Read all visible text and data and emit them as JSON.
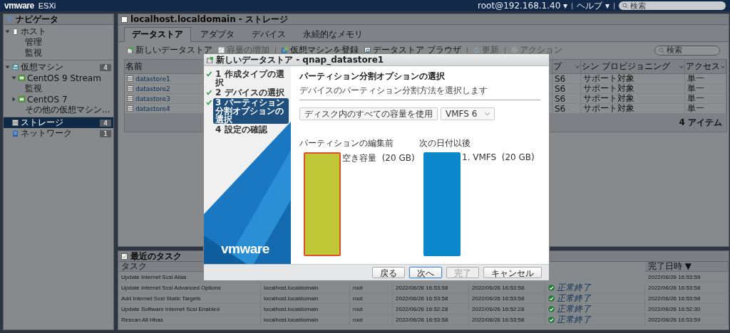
{
  "top_bar": {
    "logo": "vmware",
    "product": "ESXi",
    "user": "root@192.168.1.40 ▾",
    "help": "ヘルプ ▾",
    "search": {
      "placeholder": "検索"
    }
  },
  "navigator": {
    "title": "ナビゲータ",
    "items": [
      {
        "label": "ホスト",
        "kind": "host",
        "expanded": true,
        "selected": false,
        "children": [
          {
            "label": "管理",
            "selected": false
          },
          {
            "label": "監視",
            "selected": false
          }
        ]
      },
      {
        "label": "仮想マシン",
        "kind": "vms",
        "count": "4",
        "expanded": true,
        "selected": false,
        "children": [
          {
            "label": "CentOS 9 Stream",
            "kind": "vm",
            "expanded": true,
            "selected": false,
            "children": [
              {
                "label": "監視",
                "selected": false
              }
            ]
          },
          {
            "label": "CentOS 7",
            "kind": "vm",
            "expanded": false,
            "selected": false
          },
          {
            "label": "その他の仮想マシン...",
            "selected": false
          }
        ]
      },
      {
        "label": "ストレージ",
        "kind": "storage",
        "count": "4",
        "selected": true
      },
      {
        "label": "ネットワーク",
        "kind": "network",
        "count": "1",
        "selected": false
      }
    ]
  },
  "main": {
    "title": "localhost.localdomain - ストレージ",
    "tabs": [
      {
        "label": "データストア",
        "selected": true
      },
      {
        "label": "アダプタ",
        "selected": false
      },
      {
        "label": "デバイス",
        "selected": false
      },
      {
        "label": "永続的なメモリ",
        "selected": false
      }
    ],
    "toolbar": [
      [
        {
          "label": "新しいデータストア",
          "kind": "new",
          "disabled": false
        },
        {
          "label": "容量の増加",
          "kind": "grow",
          "disabled": true
        }
      ],
      [
        {
          "label": "仮想マシンを登録",
          "kind": "register",
          "disabled": false
        },
        {
          "label": "データストア ブラウザ",
          "kind": "browser",
          "disabled": false
        }
      ],
      [
        {
          "label": "更新",
          "kind": "refresh",
          "disabled": true
        }
      ],
      [
        {
          "label": "アクション",
          "kind": "gear",
          "disabled": true
        }
      ]
    ],
    "search": {
      "placeholder": "検索"
    },
    "table": {
      "columns": [
        "名前",
        "プ",
        "シン プロビジョニング",
        "アクセス"
      ],
      "rows": [
        [
          "datastore1",
          "S6",
          "サポート対象",
          "単一"
        ],
        [
          "datastore2",
          "S6",
          "サポート対象",
          "単一"
        ],
        [
          "datastore3",
          "S6",
          "サポート対象",
          "単一"
        ],
        [
          "datastore4",
          "S6",
          "サポート対象",
          "単一"
        ]
      ],
      "footer": "4 アイテム"
    }
  },
  "tasks": {
    "title": "最近のタスク",
    "columns": {
      "task": "タスク",
      "completed": "完了日時 ▼"
    },
    "rows": [
      {
        "task": "Update Internet Scsi Alias",
        "completed": "2022/06/26 16:53:59"
      },
      {
        "task": "Update Internet Scsi Advanced Options",
        "target": "localhost.localdomain",
        "initiator": "root",
        "queued": "2022/06/26 16:53:58",
        "started": "2022/06/26 16:53:58",
        "result": "正常終了",
        "completed": "2022/06/26 16:53:58"
      },
      {
        "task": "Add Internet Scsi Static Targets",
        "target": "localhost.localdomain",
        "initiator": "root",
        "queued": "2022/06/26 16:53:58",
        "started": "2022/06/26 16:53:58",
        "result": "正常終了",
        "completed": "2022/06/26 16:53:58"
      },
      {
        "task": "Update Software Internet Scsi Enabled",
        "target": "localhost.localdomain",
        "initiator": "root",
        "queued": "2022/06/26 16:52:28",
        "started": "2022/06/26 16:52:28",
        "result": "正常終了",
        "completed": "2022/06/26 16:52:30"
      },
      {
        "task": "Rescan All Hbas",
        "target": "localhost.localdomain",
        "initiator": "root",
        "queued": "2022/06/26 16:53:58",
        "started": "2022/06/26 16:53:58",
        "result": "正常終了",
        "completed": "2022/06/26 16:53:59"
      }
    ]
  },
  "dialog": {
    "title": "新しいデータストア - qnap_datastore1",
    "steps": [
      {
        "label": "1 作成タイプの選択",
        "done": true,
        "selected": false
      },
      {
        "label": "2 デバイスの選択",
        "done": true,
        "selected": false
      },
      {
        "label": "3 パーティション分割オプションの選択",
        "done": true,
        "selected": true
      },
      {
        "label": "4 設定の確認",
        "done": false,
        "selected": false
      }
    ],
    "brand": "vmware",
    "heading": "パーティション分割オプションの選択",
    "subtitle": "デバイスのパーティション分割方法を選択します",
    "selects": [
      {
        "value": "ディスク内のすべての容量を使用",
        "kind": "button"
      },
      {
        "value": "VMFS 6",
        "kind": "dropdown"
      }
    ],
    "layouts": [
      {
        "title": "パーティションの編集前",
        "segments": [
          {
            "label": "空き容量  (20 GB)",
            "kind": "free",
            "selected": true
          }
        ]
      },
      {
        "title": "次の日付以後",
        "segments": [
          {
            "label": "1. VMFS  (20 GB)",
            "kind": "vmfs",
            "selected": false
          }
        ]
      }
    ],
    "buttons": [
      {
        "label": "戻る",
        "kind": "normal",
        "disabled": false
      },
      {
        "label": "次へ",
        "kind": "primary",
        "disabled": false
      },
      {
        "label": "完了",
        "kind": "normal",
        "disabled": true
      },
      {
        "label": "キャンセル",
        "kind": "normal",
        "disabled": false
      }
    ]
  }
}
